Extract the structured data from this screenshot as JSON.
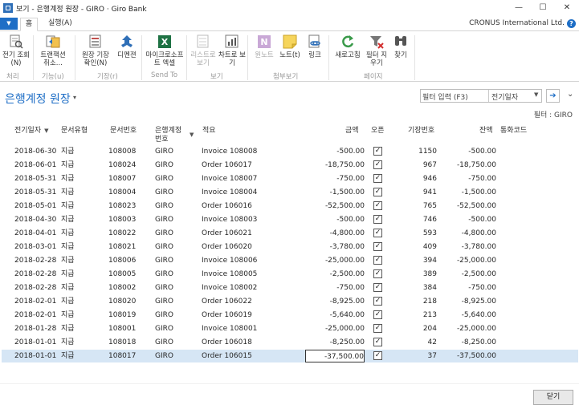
{
  "window": {
    "title": "보기 - 은행계정 원장 - GIRO · Giro Bank",
    "controls": {
      "minimize": "—",
      "maximize": "☐",
      "close": "✕"
    }
  },
  "ribbon": {
    "file_menu": "▼",
    "tabs": [
      "홈",
      "실행(A)"
    ],
    "company": "CRONUS International Ltd.",
    "help": "?",
    "buttons": [
      {
        "label": "전기 조회(N)",
        "icon": "navigate-icon"
      },
      {
        "label": "트랜잭션 취소...",
        "icon": "reverse-transaction-icon"
      },
      {
        "label": "원장 기장 확인(N)",
        "icon": "ledger-entries-icon"
      },
      {
        "label": "디멘젼",
        "icon": "dimensions-icon"
      },
      {
        "label": "마이크로소프트 엑셀",
        "icon": "excel-icon"
      },
      {
        "label": "리스트로 보기",
        "icon": "list-view-icon"
      },
      {
        "label": "차트로 보기",
        "icon": "chart-view-icon"
      },
      {
        "label": "원노트",
        "icon": "onenote-icon"
      },
      {
        "label": "노트(t)",
        "icon": "note-icon"
      },
      {
        "label": "링크",
        "icon": "link-icon"
      },
      {
        "label": "새로고침",
        "icon": "refresh-icon"
      },
      {
        "label": "필터 지우기",
        "icon": "clear-filter-icon"
      },
      {
        "label": "찾기",
        "icon": "find-icon"
      }
    ],
    "groups": [
      "처리",
      "기능(u)",
      "기장(r)",
      "Send To",
      "보기",
      "첨부보기",
      "페이지"
    ]
  },
  "page": {
    "title": "은행계정 원장",
    "title_caret": "▾",
    "filter_placeholder": "필터 입력 (F3)",
    "filter_field": "전기일자",
    "filter_drop": "▼",
    "filter_go": "➔",
    "filter_expand": "⌄",
    "filter_label": "필터 : GIRO"
  },
  "columns": {
    "posting_date": "전기일자",
    "doc_type": "문서유형",
    "doc_no": "문서번호",
    "bank_account_no": "은행계정 번호",
    "description": "적요",
    "amount": "금액",
    "open": "오픈",
    "entry_no": "기장번호",
    "remaining": "잔액",
    "currency": "통화코드"
  },
  "rows": [
    {
      "date": "2018-06-30",
      "type": "지급",
      "doc": "108008",
      "bank": "GIRO",
      "desc": "Invoice 108008",
      "amount": "-500.00",
      "open": true,
      "entry": "1150",
      "rem": "-500.00"
    },
    {
      "date": "2018-06-01",
      "type": "지급",
      "doc": "108024",
      "bank": "GIRO",
      "desc": "Order 106017",
      "amount": "-18,750.00",
      "open": true,
      "entry": "967",
      "rem": "-18,750.00"
    },
    {
      "date": "2018-05-31",
      "type": "지급",
      "doc": "108007",
      "bank": "GIRO",
      "desc": "Invoice 108007",
      "amount": "-750.00",
      "open": true,
      "entry": "946",
      "rem": "-750.00"
    },
    {
      "date": "2018-05-31",
      "type": "지급",
      "doc": "108004",
      "bank": "GIRO",
      "desc": "Invoice 108004",
      "amount": "-1,500.00",
      "open": true,
      "entry": "941",
      "rem": "-1,500.00"
    },
    {
      "date": "2018-05-01",
      "type": "지급",
      "doc": "108023",
      "bank": "GIRO",
      "desc": "Order 106016",
      "amount": "-52,500.00",
      "open": true,
      "entry": "765",
      "rem": "-52,500.00"
    },
    {
      "date": "2018-04-30",
      "type": "지급",
      "doc": "108003",
      "bank": "GIRO",
      "desc": "Invoice 108003",
      "amount": "-500.00",
      "open": true,
      "entry": "746",
      "rem": "-500.00"
    },
    {
      "date": "2018-04-01",
      "type": "지급",
      "doc": "108022",
      "bank": "GIRO",
      "desc": "Order 106021",
      "amount": "-4,800.00",
      "open": true,
      "entry": "593",
      "rem": "-4,800.00"
    },
    {
      "date": "2018-03-01",
      "type": "지급",
      "doc": "108021",
      "bank": "GIRO",
      "desc": "Order 106020",
      "amount": "-3,780.00",
      "open": true,
      "entry": "409",
      "rem": "-3,780.00"
    },
    {
      "date": "2018-02-28",
      "type": "지급",
      "doc": "108006",
      "bank": "GIRO",
      "desc": "Invoice 108006",
      "amount": "-25,000.00",
      "open": true,
      "entry": "394",
      "rem": "-25,000.00"
    },
    {
      "date": "2018-02-28",
      "type": "지급",
      "doc": "108005",
      "bank": "GIRO",
      "desc": "Invoice 108005",
      "amount": "-2,500.00",
      "open": true,
      "entry": "389",
      "rem": "-2,500.00"
    },
    {
      "date": "2018-02-28",
      "type": "지급",
      "doc": "108002",
      "bank": "GIRO",
      "desc": "Invoice 108002",
      "amount": "-750.00",
      "open": true,
      "entry": "384",
      "rem": "-750.00"
    },
    {
      "date": "2018-02-01",
      "type": "지급",
      "doc": "108020",
      "bank": "GIRO",
      "desc": "Order 106022",
      "amount": "-8,925.00",
      "open": true,
      "entry": "218",
      "rem": "-8,925.00"
    },
    {
      "date": "2018-02-01",
      "type": "지급",
      "doc": "108019",
      "bank": "GIRO",
      "desc": "Order 106019",
      "amount": "-5,640.00",
      "open": true,
      "entry": "213",
      "rem": "-5,640.00"
    },
    {
      "date": "2018-01-28",
      "type": "지급",
      "doc": "108001",
      "bank": "GIRO",
      "desc": "Invoice 108001",
      "amount": "-25,000.00",
      "open": true,
      "entry": "204",
      "rem": "-25,000.00"
    },
    {
      "date": "2018-01-01",
      "type": "지급",
      "doc": "108018",
      "bank": "GIRO",
      "desc": "Order 106018",
      "amount": "-8,250.00",
      "open": true,
      "entry": "42",
      "rem": "-8,250.00"
    },
    {
      "date": "2018-01-01",
      "type": "지급",
      "doc": "108017",
      "bank": "GIRO",
      "desc": "Order 106015",
      "amount": "-37,500.00",
      "open": true,
      "entry": "37",
      "rem": "-37,500.00",
      "selected": true
    }
  ],
  "footer": {
    "close_label": "닫기"
  }
}
